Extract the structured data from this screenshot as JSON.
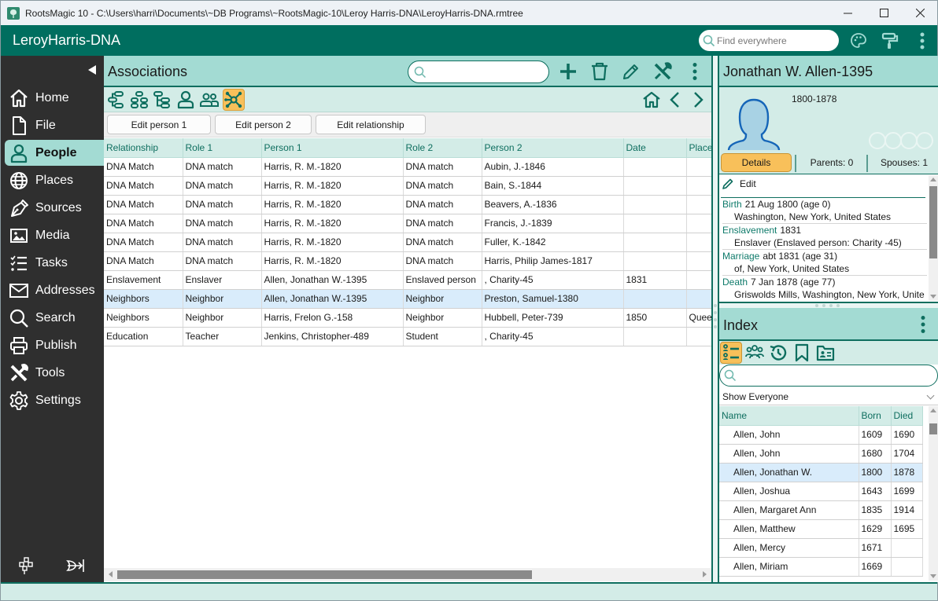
{
  "window": {
    "title": "RootsMagic 10 - C:\\Users\\harri\\Documents\\~DB Programs\\~RootsMagic-10\\Leroy Harris-DNA\\LeroyHarris-DNA.rmtree",
    "controls": [
      "minimize",
      "maximize",
      "close"
    ]
  },
  "appbar": {
    "database_name": "LeroyHarris-DNA",
    "find_placeholder": "Find everywhere",
    "icons": [
      "palette-icon",
      "paint-roller-icon",
      "more-vertical-icon"
    ]
  },
  "nav": {
    "items": [
      {
        "label": "Home",
        "icon": "home-icon"
      },
      {
        "label": "File",
        "icon": "file-icon"
      },
      {
        "label": "People",
        "icon": "person-icon",
        "active": true
      },
      {
        "label": "Places",
        "icon": "globe-icon"
      },
      {
        "label": "Sources",
        "icon": "pen-nib-icon"
      },
      {
        "label": "Media",
        "icon": "image-icon"
      },
      {
        "label": "Tasks",
        "icon": "checklist-icon"
      },
      {
        "label": "Addresses",
        "icon": "envelope-icon"
      },
      {
        "label": "Search",
        "icon": "search-icon"
      },
      {
        "label": "Publish",
        "icon": "printer-icon"
      },
      {
        "label": "Tools",
        "icon": "tools-icon"
      },
      {
        "label": "Settings",
        "icon": "gear-icon"
      }
    ],
    "bottom_icons": [
      "family-tree-icon",
      "tree-sprout-icon"
    ]
  },
  "main": {
    "title": "Associations",
    "search_placeholder": "",
    "toolbar": [
      "add-icon",
      "delete-icon",
      "edit-icon",
      "tools-icon",
      "more-vertical-icon"
    ],
    "views": [
      "pedigree-view",
      "family-view",
      "descendants-view",
      "person-view",
      "people-view",
      "associations-view"
    ],
    "active_view": "associations-view",
    "buttons": {
      "edit_person_1": "Edit person 1",
      "edit_person_2": "Edit person 2",
      "edit_relationship": "Edit relationship"
    },
    "columns": [
      "Relationship",
      "Role 1",
      "Person 1",
      "Role 2",
      "Person 2",
      "Date",
      "Place"
    ],
    "rows": [
      [
        "DNA Match",
        "DNA match",
        "Harris, R. M.-1820",
        "DNA match",
        "Aubin, J.-1846",
        "",
        ""
      ],
      [
        "DNA Match",
        "DNA match",
        "Harris, R. M.-1820",
        "DNA match",
        "Bain, S.-1844",
        "",
        ""
      ],
      [
        "DNA Match",
        "DNA match",
        "Harris, R. M.-1820",
        "DNA match",
        "Beavers, A.-1836",
        "",
        ""
      ],
      [
        "DNA Match",
        "DNA match",
        "Harris, R. M.-1820",
        "DNA match",
        "Francis, J.-1839",
        "",
        ""
      ],
      [
        "DNA Match",
        "DNA match",
        "Harris, R. M.-1820",
        "DNA match",
        "Fuller, K.-1842",
        "",
        ""
      ],
      [
        "DNA Match",
        "DNA match",
        "Harris, R. M.-1820",
        "DNA match",
        "Harris, Philip James-1817",
        "",
        ""
      ],
      [
        "Enslavement",
        "Enslaver",
        "Allen, Jonathan W.-1395",
        "Enslaved person",
        ", Charity-45",
        "1831",
        ""
      ],
      [
        "Neighbors",
        "Neighbor",
        "Allen, Jonathan W.-1395",
        "Neighbor",
        "Preston, Samuel-1380",
        "",
        ""
      ],
      [
        "Neighbors",
        "Neighbor",
        "Harris, Frelon G.-158",
        "Neighbor",
        "Hubbell, Peter-739",
        "1850",
        "Quee"
      ],
      [
        "Education",
        "Teacher",
        "Jenkins, Christopher-489",
        "Student",
        ", Charity-45",
        "",
        ""
      ]
    ],
    "selected_row": 7
  },
  "person": {
    "name": "Jonathan W. Allen-1395",
    "lifespan": "1800-1878",
    "tabs": {
      "details": "Details",
      "parents": "Parents: 0",
      "spouses": "Spouses: 1"
    },
    "edit_label": "Edit",
    "facts": [
      {
        "type": "Birth",
        "date": "21 Aug 1800 (age 0)",
        "detail": "Washington, New York, United States"
      },
      {
        "type": "Enslavement",
        "date": "1831",
        "detail": "Enslaver (Enslaved person: Charity -45)"
      },
      {
        "type": "Marriage",
        "date": "abt 1831 (age 31)",
        "detail": "of, New York, United States"
      },
      {
        "type": "Death",
        "date": "7 Jan 1878 (age 77)",
        "detail": "Griswolds Mills, Washington, New York, Unite"
      }
    ]
  },
  "index": {
    "title": "Index",
    "tools": [
      "name-list-icon",
      "groups-icon",
      "history-icon",
      "bookmark-icon",
      "folder-person-icon"
    ],
    "search_placeholder": "",
    "filter": "Show Everyone",
    "columns": [
      "Name",
      "Born",
      "Died"
    ],
    "rows": [
      [
        "Allen, John",
        "1609",
        "1690"
      ],
      [
        "Allen, John",
        "1680",
        "1704"
      ],
      [
        "Allen, Jonathan W.",
        "1800",
        "1878"
      ],
      [
        "Allen, Joshua",
        "1643",
        "1699"
      ],
      [
        "Allen, Margaret Ann",
        "1835",
        "1914"
      ],
      [
        "Allen, Matthew",
        "1629",
        "1695"
      ],
      [
        "Allen, Mercy",
        "1671",
        ""
      ],
      [
        "Allen, Miriam",
        "1669",
        ""
      ]
    ],
    "selected_row": 2
  },
  "colors": {
    "brand": "#006e5f",
    "header_bg": "#a3dbd3",
    "subheader_bg": "#d3ece7",
    "active_tab": "#f8c05a",
    "selected_row": "#d9ecfb",
    "nav_bg": "#2f2f2f"
  }
}
